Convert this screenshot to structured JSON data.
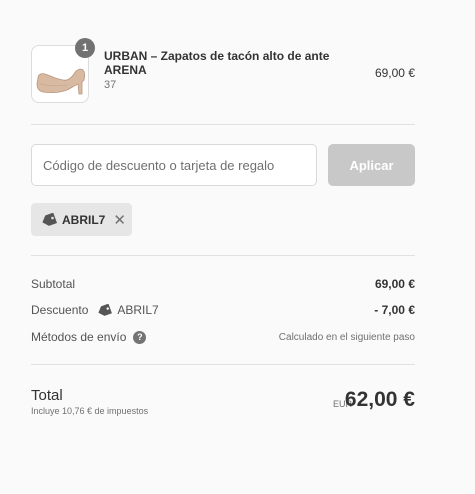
{
  "product": {
    "quantity": "1",
    "name": "URBAN – Zapatos de tacón alto de ante ARENA",
    "variant": "37",
    "price": "69,00 €",
    "image_icon": "high-heel-shoe"
  },
  "discount_form": {
    "placeholder": "Código de descuento o tarjeta de regalo",
    "value": "",
    "apply_label": "Aplicar"
  },
  "applied_tag": {
    "code": "ABRIL7",
    "icon": "price-tag-icon",
    "remove_icon": "✕"
  },
  "summary": {
    "subtotal_label": "Subtotal",
    "subtotal_value": "69,00 €",
    "discount_label": "Descuento",
    "discount_code": "ABRIL7",
    "discount_value": "- 7,00 €",
    "shipping_label": "Métodos de envío",
    "shipping_help": "?",
    "shipping_value": "Calculado en el siguiente paso"
  },
  "total": {
    "label": "Total",
    "tax_note": "Incluye 10,76 € de impuestos",
    "currency": "EUR",
    "amount": "62,00 €"
  },
  "colors": {
    "background": "#fafafa",
    "button_disabled": "#c8c8c8",
    "badge": "#727272",
    "tag_bg": "#e6e6e6"
  }
}
